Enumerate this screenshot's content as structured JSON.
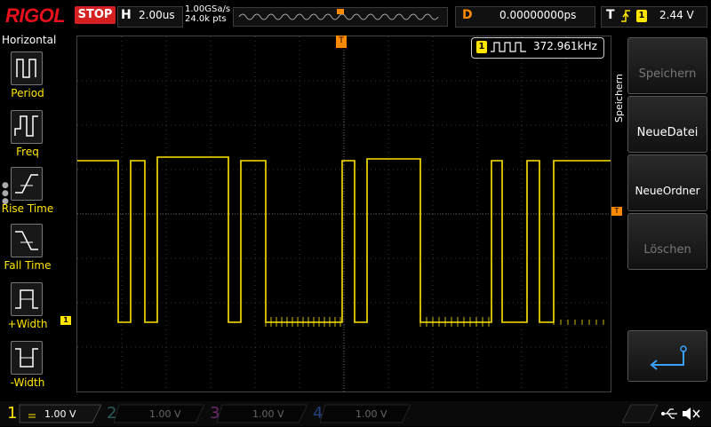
{
  "brand": "RIGOL",
  "run_state": "STOP",
  "horizontal": {
    "letter": "H",
    "timebase": "2.00us",
    "sample_rate": "1.00GSa/s",
    "points": "24.0k pts"
  },
  "delay": {
    "letter": "D",
    "value": "0.00000000ps"
  },
  "trigger": {
    "letter": "T",
    "channel": "1",
    "level": "2.44 V"
  },
  "left_menu": {
    "title": "Horizontal",
    "items": [
      "Period",
      "Freq",
      "Rise Time",
      "Fall Time",
      "+Width",
      "-Width"
    ]
  },
  "measurement": {
    "channel": "1",
    "frequency": "372.961kHz"
  },
  "right_menu": {
    "section": "Speichern",
    "buttons": [
      "Speichern",
      "NeueDatei",
      "NeueOrdner",
      "Löschen"
    ]
  },
  "channels": [
    {
      "num": "1",
      "scale": "1.00 V",
      "color": "#ffe500"
    },
    {
      "num": "2",
      "scale": "1.00 V",
      "color": "#00c0c0"
    },
    {
      "num": "3",
      "scale": "1.00 V",
      "color": "#d020d0"
    },
    {
      "num": "4",
      "scale": "1.00 V",
      "color": "#2070ff"
    }
  ],
  "markers": {
    "ch1": "1",
    "trig_top": "T",
    "trig_right": "T"
  },
  "colors": {
    "ch1": "#ffe500",
    "trigger": "#ff8a00",
    "stop": "#d42020",
    "brand": "#e8101a"
  }
}
